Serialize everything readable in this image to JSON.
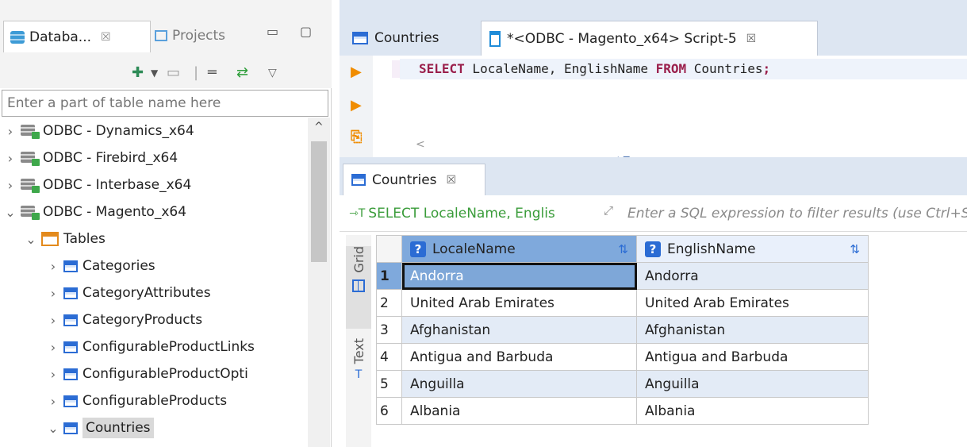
{
  "left_panel": {
    "tabs": [
      {
        "label": "Databa...",
        "close": "☒"
      },
      {
        "label": "Projects"
      }
    ],
    "filter_placeholder": "Enter a part of table name here",
    "tree": [
      {
        "label": "ODBC - Dynamics_x64",
        "type": "datasource",
        "expanded": false
      },
      {
        "label": "ODBC - Firebird_x64",
        "type": "datasource",
        "expanded": false
      },
      {
        "label": "ODBC - Interbase_x64",
        "type": "datasource",
        "expanded": false
      },
      {
        "label": "ODBC - Magento_x64",
        "type": "datasource",
        "expanded": true
      },
      {
        "label": "Tables",
        "type": "folder",
        "expanded": true
      },
      {
        "label": "Categories",
        "type": "table"
      },
      {
        "label": "CategoryAttributes",
        "type": "table"
      },
      {
        "label": "CategoryProducts",
        "type": "table"
      },
      {
        "label": "ConfigurableProductLinks",
        "type": "table"
      },
      {
        "label": "ConfigurableProductOpti",
        "type": "table"
      },
      {
        "label": "ConfigurableProducts",
        "type": "table"
      },
      {
        "label": "Countries",
        "type": "table",
        "expanded": true,
        "selected": true
      }
    ]
  },
  "editor": {
    "tabs": [
      {
        "label": "Countries"
      },
      {
        "label": "*<ODBC - Magento_x64> Script-5",
        "active": true,
        "close": "☒"
      }
    ],
    "sql": {
      "kw1": "SELECT",
      "cols": " LocaleName, EnglishName ",
      "kw2": "FROM",
      "rest": " Countries",
      "semicolon": ";"
    }
  },
  "results": {
    "tab_label": "Countries",
    "tab_close": "☒",
    "query_preview": "SELECT LocaleName, Englis",
    "filter_placeholder": "Enter a SQL expression to filter results (use Ctrl+Space)",
    "side_tabs": [
      "Grid",
      "Text"
    ],
    "columns": [
      "LocaleName",
      "EnglishName"
    ],
    "rows": [
      [
        "1",
        "Andorra",
        "Andorra"
      ],
      [
        "2",
        "United Arab Emirates",
        "United Arab Emirates"
      ],
      [
        "3",
        "Afghanistan",
        "Afghanistan"
      ],
      [
        "4",
        "Antigua and Barbuda",
        "Antigua and Barbuda"
      ],
      [
        "5",
        "Anguilla",
        "Anguilla"
      ],
      [
        "6",
        "Albania",
        "Albania"
      ]
    ]
  },
  "colors": {
    "accent": "#2b6cd4",
    "selection": "#7fa9dc",
    "run": "#f08c00",
    "sql_keyword": "#9a1f4b"
  }
}
